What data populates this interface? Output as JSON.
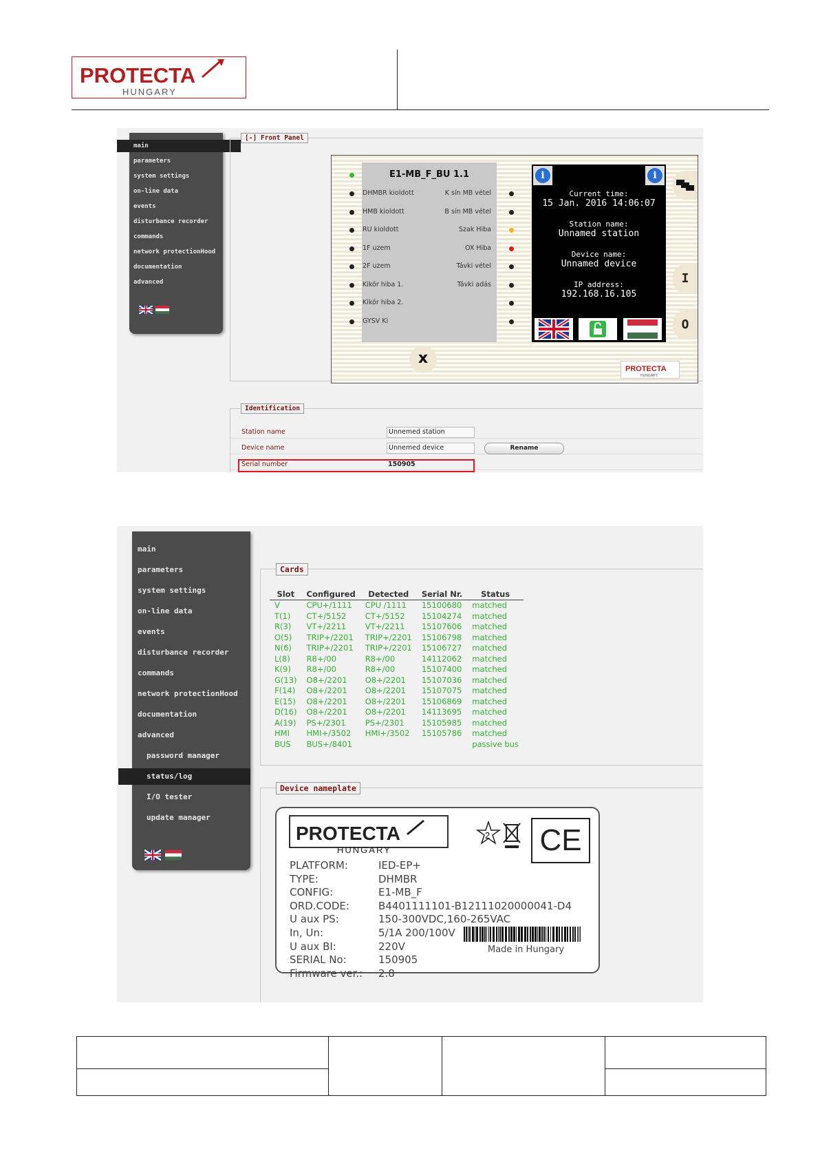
{
  "header": {
    "logo": {
      "brand": "PROTECTA",
      "sub": "HUNGARY"
    }
  },
  "shot1": {
    "sidebar": {
      "items": [
        "main",
        "parameters",
        "system settings",
        "on-line data",
        "events",
        "disturbance recorder",
        "commands",
        "network protectionHood",
        "documentation",
        "advanced"
      ],
      "active_index": 0
    },
    "front_panel": {
      "legend": "[-] Front Panel",
      "device_title": "E1-MB_F_BU 1.1",
      "left_leds": [
        {
          "label": "DHMBR kioldott",
          "color": "#222222"
        },
        {
          "label": "HMB kioldott",
          "color": "#222222"
        },
        {
          "label": "RU kioldott",
          "color": "#222222"
        },
        {
          "label": "1F uzem",
          "color": "#222222"
        },
        {
          "label": "2F uzem",
          "color": "#222222"
        },
        {
          "label": "Kikör hiba 1.",
          "color": "#222222"
        },
        {
          "label": "Kikör hiba 2.",
          "color": "#222222"
        },
        {
          "label": "GYSV Ki",
          "color": "#222222"
        }
      ],
      "right_leds": [
        {
          "label": "K sín MB vétel",
          "color": "#222222"
        },
        {
          "label": "B sín MB vétel",
          "color": "#222222"
        },
        {
          "label": "Szak Hiba",
          "color": "#f0b020"
        },
        {
          "label": "OX Hiba",
          "color": "#d02020"
        },
        {
          "label": "Távki vétel",
          "color": "#222222"
        },
        {
          "label": "Távki adás",
          "color": "#222222"
        },
        {
          "label": "",
          "color": "#222222"
        },
        {
          "label": "",
          "color": "#222222"
        }
      ],
      "status_led_color": "#33bb33",
      "screen": {
        "time_label": "Current time:",
        "time_value": "15 Jan. 2016 14:06:07",
        "station_label": "Station name:",
        "station_value": "Unnamed station",
        "device_label": "Device name:",
        "device_value": "Unnamed device",
        "ip_label": "IP address:",
        "ip_value": "192.168.16.105",
        "info_icon": "i"
      },
      "side_buttons": [
        "I",
        "O"
      ],
      "close_button": "x"
    },
    "identification": {
      "legend": "Identification",
      "rows": [
        {
          "label": "Station name",
          "value": "Unnemed station"
        },
        {
          "label": "Device name",
          "value": "Unnemed device"
        },
        {
          "label": "Serial number",
          "value": "150905"
        }
      ],
      "rename_button": "Rename"
    }
  },
  "shot2": {
    "sidebar": {
      "items": [
        "main",
        "parameters",
        "system settings",
        "on-line data",
        "events",
        "disturbance recorder",
        "commands",
        "network protectionHood",
        "documentation",
        "advanced"
      ],
      "subitems": [
        "password manager",
        "status/log",
        "I/O tester",
        "update manager"
      ],
      "active_sub_index": 1
    },
    "cards": {
      "legend": "Cards",
      "columns": [
        "Slot",
        "Configured",
        "Detected",
        "Serial Nr.",
        "Status"
      ],
      "rows": [
        [
          "V",
          "CPU+/1111",
          "CPU /1111",
          "15100680",
          "matched"
        ],
        [
          "T(1)",
          "CT+/5152",
          "CT+/5152",
          "15104274",
          "matched"
        ],
        [
          "R(3)",
          "VT+/2211",
          "VT+/2211",
          "15107606",
          "matched"
        ],
        [
          "O(5)",
          "TRIP+/2201",
          "TRIP+/2201",
          "15106798",
          "matched"
        ],
        [
          "N(6)",
          "TRIP+/2201",
          "TRIP+/2201",
          "15106727",
          "matched"
        ],
        [
          "L(8)",
          "R8+/00",
          "R8+/00",
          "14112062",
          "matched"
        ],
        [
          "K(9)",
          "R8+/00",
          "R8+/00",
          "15107400",
          "matched"
        ],
        [
          "G(13)",
          "O8+/2201",
          "O8+/2201",
          "15107036",
          "matched"
        ],
        [
          "F(14)",
          "O8+/2201",
          "O8+/2201",
          "15107075",
          "matched"
        ],
        [
          "E(15)",
          "O8+/2201",
          "O8+/2201",
          "15106869",
          "matched"
        ],
        [
          "D(16)",
          "O8+/2201",
          "O8+/2201",
          "14113695",
          "matched"
        ],
        [
          "A(19)",
          "PS+/2301",
          "PS+/2301",
          "15105985",
          "matched"
        ],
        [
          "HMI",
          "HMI+/3502",
          "HMI+/3502",
          "15105786",
          "matched"
        ],
        [
          "BUS",
          "BUS+/8401",
          "",
          "",
          "passive bus"
        ]
      ]
    },
    "nameplate": {
      "legend": "Device nameplate",
      "rows": [
        {
          "label": "PLATFORM:",
          "value": "IED-EP+"
        },
        {
          "label": "TYPE:",
          "value": "DHMBR"
        },
        {
          "label": "CONFIG:",
          "value": "E1-MB_F"
        },
        {
          "label": "ORD.CODE:",
          "value": "B4401111101-B12111020000041-D4"
        },
        {
          "label": "U aux PS:",
          "value": "150-300VDC,160-265VAC"
        },
        {
          "label": "In, Un:",
          "value": "5/1A 200/100V"
        },
        {
          "label": "U aux BI:",
          "value": "220V"
        },
        {
          "label": "SERIAL No:",
          "value": "150905"
        },
        {
          "label": "Firmware ver.:",
          "value": "2.8"
        }
      ],
      "made_in": "Made in Hungary",
      "ce_mark": "CE",
      "star_number": "2"
    }
  }
}
